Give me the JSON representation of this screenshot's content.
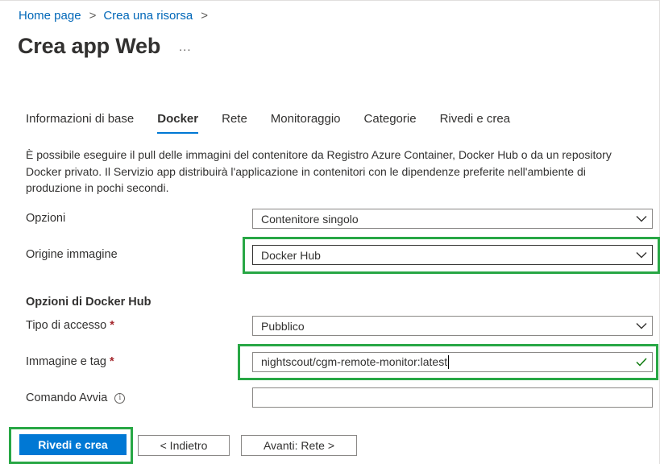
{
  "breadcrumb": {
    "items": [
      "Home page",
      "Crea una risorsa"
    ],
    "separator": ">"
  },
  "page": {
    "title": "Crea app Web",
    "more_label": "..."
  },
  "tabs": [
    {
      "label": "Informazioni di base",
      "active": false
    },
    {
      "label": "Docker",
      "active": true
    },
    {
      "label": "Rete",
      "active": false
    },
    {
      "label": "Monitoraggio",
      "active": false
    },
    {
      "label": "Categorie",
      "active": false
    },
    {
      "label": "Rivedi e crea",
      "active": false
    }
  ],
  "description": "È possibile eseguire il pull delle immagini del contenitore da Registro Azure Container, Docker Hub o da un repository Docker privato. Il Servizio app distribuirà l'applicazione in contenitori con le dipendenze preferite nell'ambiente di produzione in pochi secondi.",
  "form": {
    "options": {
      "label": "Opzioni",
      "value": "Contenitore singolo"
    },
    "image_source": {
      "label": "Origine immagine",
      "value": "Docker Hub"
    },
    "docker_hub_section_title": "Opzioni di Docker Hub",
    "access_type": {
      "label": "Tipo di accesso",
      "required_mark": "*",
      "value": "Pubblico"
    },
    "image_tag": {
      "label": "Immagine e tag",
      "required_mark": "*",
      "value": "nightscout/cgm-remote-monitor:latest"
    },
    "startup_command": {
      "label": "Comando Avvia",
      "info_glyph": "i",
      "value": ""
    }
  },
  "footer": {
    "review_create_label": "Rivedi e crea",
    "previous_label": "< Indietro",
    "next_label": "Avanti: Rete >"
  },
  "colors": {
    "accent": "#0078d4",
    "link": "#0067b8",
    "highlight": "#28a745",
    "required": "#a4262c",
    "valid": "#107c10"
  },
  "icons": {
    "dropdown": "chevron-down-icon",
    "valid": "checkmark-icon",
    "info": "info-icon",
    "more": "ellipsis-icon"
  }
}
